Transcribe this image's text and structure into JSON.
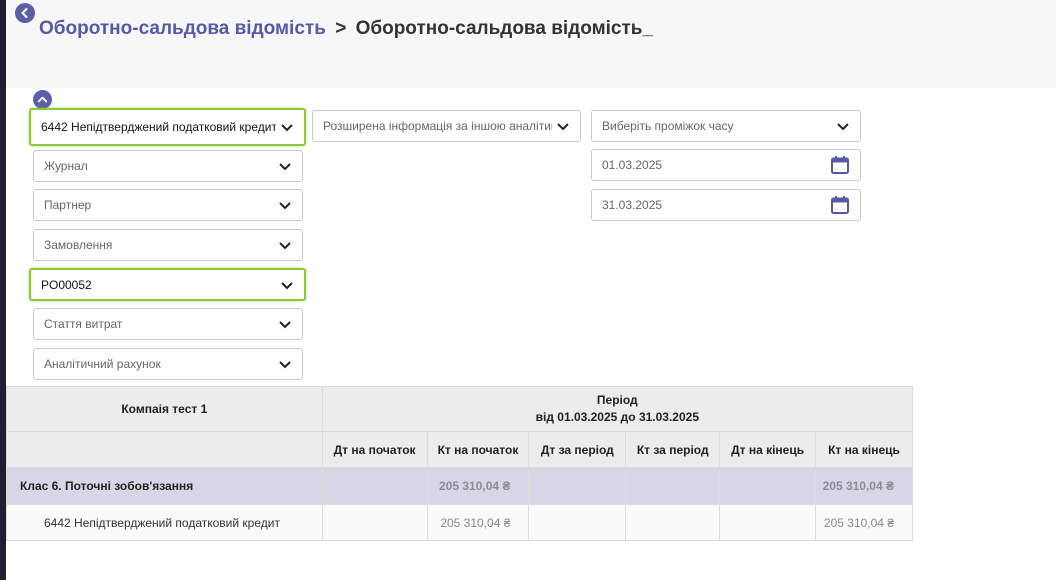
{
  "breadcrumb": {
    "parent": "Оборотно-сальдова відомість",
    "separator": ">",
    "current": "Оборотно-сальдова відомість_"
  },
  "filters": {
    "account": "6442 Непідтверджений податковий кредит",
    "journal": "Журнал",
    "partner": "Партнер",
    "order": "Замовлення",
    "document": "PO00052",
    "expense_item": "Стаття витрат",
    "analytic_account": "Аналітичний рахунок",
    "extended_info": "Розширена інформація за іншою аналітико",
    "period_select": "Виберіть проміжок часу",
    "date_from": "01.03.2025",
    "date_to": "31.03.2025"
  },
  "table": {
    "company": "Компаія тест 1",
    "period_label": "Період",
    "period_range": "від 01.03.2025 до 31.03.2025",
    "columns": [
      "Дт на початок",
      "Кт на початок",
      "Дт за період",
      "Кт за період",
      "Дт на кінець",
      "Кт на кінець"
    ],
    "rows": [
      {
        "label": "Клас 6. Поточні зобов'язання",
        "values": [
          "",
          "205 310,04 ₴",
          "",
          "",
          "",
          "205 310,04 ₴"
        ]
      },
      {
        "label": "6442 Непідтверджений податковий кредит",
        "values": [
          "",
          "205 310,04 ₴",
          "",
          "",
          "",
          "205 310,04 ₴"
        ]
      }
    ]
  },
  "colors": {
    "accent": "#5559a8",
    "selected_border": "#8dc63f",
    "class_row_bg": "#d8d6e6",
    "header_bg": "#f7f7f7"
  },
  "icons": {
    "back": "chevron-left-circle-icon",
    "collapse": "chevron-up-circle-icon",
    "dropdown": "chevron-down-icon",
    "calendar": "calendar-icon"
  }
}
